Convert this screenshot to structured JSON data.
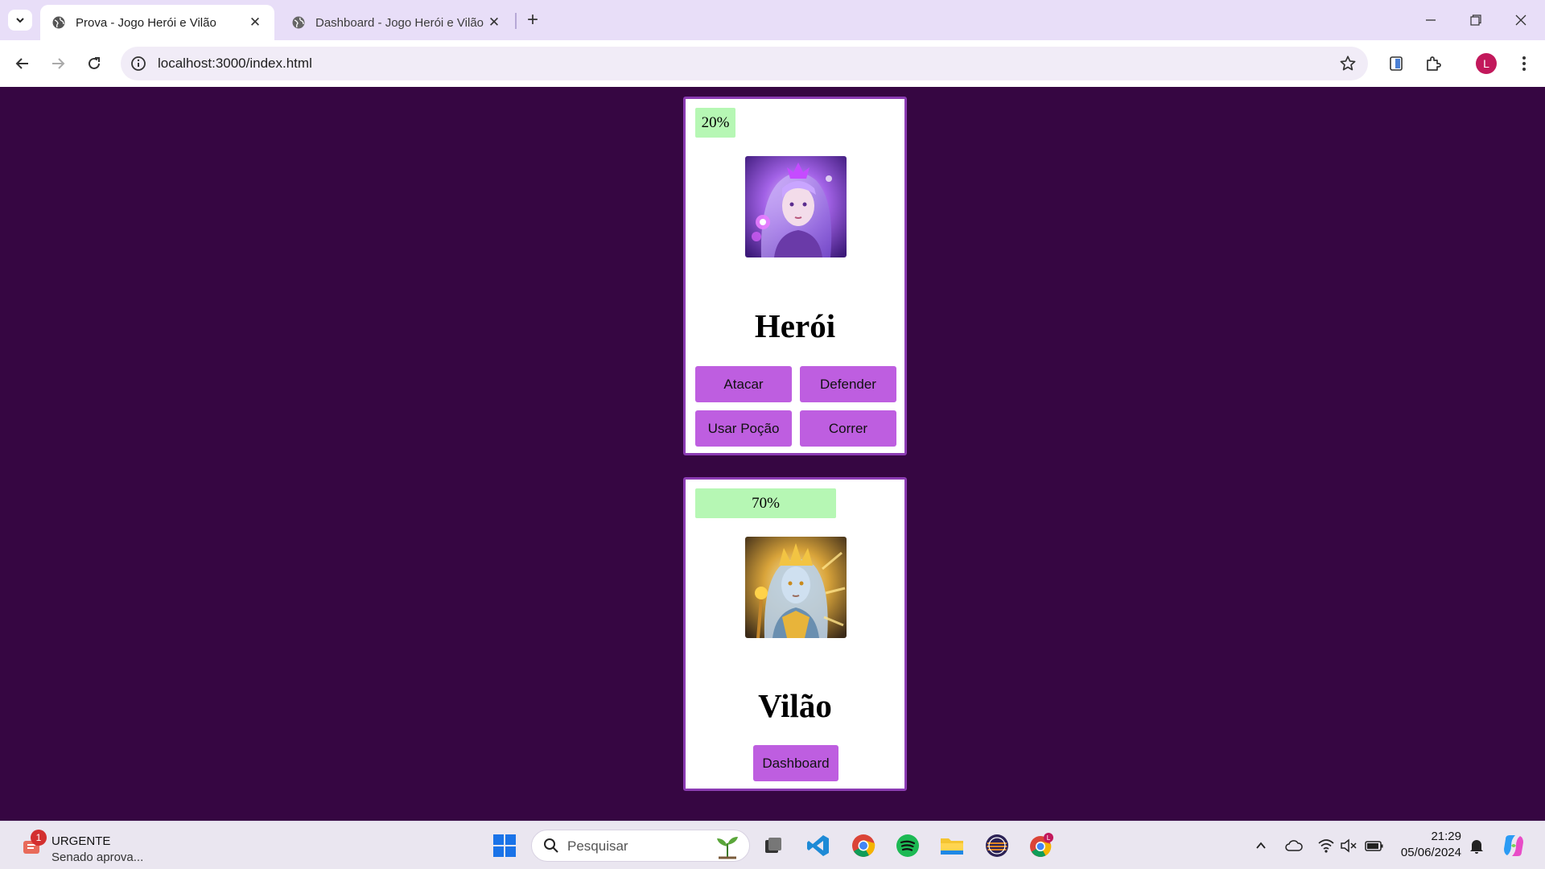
{
  "browser": {
    "tabs": [
      {
        "title": "Prova - Jogo Herói e Vilão",
        "active": true
      },
      {
        "title": "Dashboard - Jogo Herói e Vilão",
        "active": false
      }
    ],
    "url": "localhost:3000/index.html",
    "profile_initial": "L"
  },
  "game": {
    "hero": {
      "hp_text": "20%",
      "hp_percent": 20,
      "name": "Herói",
      "actions": {
        "attack": "Atacar",
        "defend": "Defender",
        "potion": "Usar Poção",
        "run": "Correr"
      }
    },
    "villain": {
      "hp_text": "70%",
      "hp_percent": 70,
      "name": "Vilão",
      "dashboard_label": "Dashboard"
    },
    "colors": {
      "background": "#360642",
      "card_border": "#8b3bb3",
      "button": "#be5ee0",
      "hp_bar": "#b6f7b4"
    }
  },
  "taskbar": {
    "news": {
      "badge": "1",
      "headline": "URGENTE",
      "subline": "Senado aprova..."
    },
    "search_placeholder": "Pesquisar",
    "time": "21:29",
    "date": "05/06/2024"
  }
}
